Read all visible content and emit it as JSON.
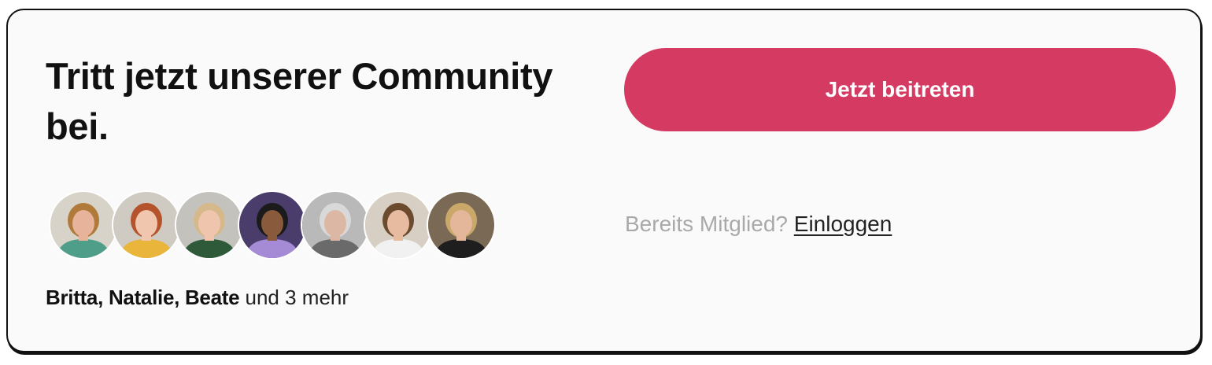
{
  "community": {
    "title": "Tritt jetzt unserer Community bei.",
    "join_button": "Jetzt beitreten",
    "login_prompt": "Bereits Mitglied?",
    "login_link": "Einloggen",
    "members_names": "Britta, Natalie, Beate",
    "members_more": "und 3 mehr",
    "avatars": [
      {
        "name": "avatar-1",
        "bg": "#d8d3c8",
        "skin": "#e7b39a",
        "hair": "#b07a3a",
        "shirt": "#4f9e8a"
      },
      {
        "name": "avatar-2",
        "bg": "#cfcac2",
        "skin": "#f0c7ae",
        "hair": "#b5542c",
        "shirt": "#e9b53a"
      },
      {
        "name": "avatar-3",
        "bg": "#c4c2bd",
        "skin": "#efc6ad",
        "hair": "#d6b98a",
        "shirt": "#2f5a3a"
      },
      {
        "name": "avatar-4",
        "bg": "#4a3d6b",
        "skin": "#8a5a3c",
        "hair": "#1b1b1b",
        "shirt": "#a58ad6"
      },
      {
        "name": "avatar-5",
        "bg": "#b9b9b9",
        "skin": "#dcb8a4",
        "hair": "#d9d9d9",
        "shirt": "#6a6a6a"
      },
      {
        "name": "avatar-6",
        "bg": "#d7cfc4",
        "skin": "#e6bba0",
        "hair": "#6b4a2e",
        "shirt": "#f1f1f1"
      },
      {
        "name": "avatar-7",
        "bg": "#7a6a55",
        "skin": "#e4b79b",
        "hair": "#c9a86a",
        "shirt": "#1e1e1e"
      }
    ],
    "colors": {
      "accent": "#d53a63",
      "border": "#111111",
      "muted_text": "#a9a9a9"
    }
  }
}
